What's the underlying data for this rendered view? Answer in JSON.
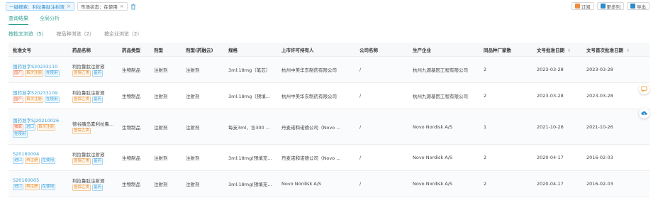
{
  "filters": [
    {
      "label": "一键搜索：利拉鲁肽注射液",
      "active": true
    },
    {
      "label": "市场状态：在使用",
      "active": false
    }
  ],
  "actions": [
    {
      "label": "订阅",
      "color": "#f08a3c"
    },
    {
      "label": "更多列",
      "color": "#2b8ccc"
    },
    {
      "label": "导出",
      "color": "#2b8ccc"
    }
  ],
  "tabs": [
    {
      "label": "查询结果"
    },
    {
      "label": "全局分析"
    }
  ],
  "subtabs": [
    {
      "label": "按批文浏览（5）"
    },
    {
      "label": "按品种浏览（2）"
    },
    {
      "label": "按企业浏览（2）"
    }
  ],
  "columns": [
    {
      "label": "批准文号",
      "sort": false
    },
    {
      "label": "药品名称",
      "sort": false
    },
    {
      "label": "药品类型",
      "sort": false
    },
    {
      "label": "剂型",
      "sort": false
    },
    {
      "label": "剂型(药融云)",
      "sort": false
    },
    {
      "label": "规格",
      "sort": false
    },
    {
      "label": "上市许可持有人",
      "sort": false
    },
    {
      "label": "公司名称",
      "sort": false
    },
    {
      "label": "生产企业",
      "sort": false
    },
    {
      "label": "同品种厂家数",
      "sort": false
    },
    {
      "label": "文号批准日期",
      "sort": true
    },
    {
      "label": "文号首次批准日期",
      "sort": true
    }
  ],
  "rows": [
    {
      "approval": "国药准字S20233110",
      "approval_tags": [
        [
          "国产",
          "red"
        ],
        [
          "首次注册",
          "orange"
        ],
        [
          "在使用",
          "teal"
        ]
      ],
      "drug": "利拉鲁肽注射液",
      "drug_tags": [
        [
          "医保乙类",
          "orange"
        ],
        [
          "基药",
          "blue"
        ]
      ],
      "type": "生物制品",
      "form": "注射剂",
      "form2": "注射剂",
      "spec": "3ml:18mg（笔芯）",
      "holder": "杭州中美华东制药有限公司",
      "company": "/",
      "maker": "杭州九源基因工程有限公司",
      "count": "2",
      "date": "2023-03-28",
      "first_date": "2023-03-28"
    },
    {
      "approval": "国药准字S20233109",
      "approval_tags": [
        [
          "国产",
          "red"
        ],
        [
          "首次注册",
          "orange"
        ],
        [
          "在使用",
          "teal"
        ]
      ],
      "drug": "利拉鲁肽注射液",
      "drug_tags": [
        [
          "医保乙类",
          "orange"
        ],
        [
          "基药",
          "blue"
        ]
      ],
      "type": "生物制品",
      "form": "注射剂",
      "form2": "注射剂",
      "spec": "3ml:18mg（预填...",
      "holder": "杭州中美华东制药有限公司",
      "company": "/",
      "maker": "杭州九源基因工程有限公司",
      "count": "2",
      "date": "2023-03-28",
      "first_date": "2023-03-28"
    },
    {
      "approval": "国药准字SJ20210026",
      "approval_tags": [
        [
          "独家",
          "red"
        ],
        [
          "进口",
          "blue"
        ],
        [
          "首次注册",
          "orange"
        ],
        [
          "在使用",
          "teal"
        ]
      ],
      "drug": "德谷胰岛素利拉鲁...",
      "drug_tags": [
        [
          "医保乙类",
          "orange"
        ]
      ],
      "type": "生物制品",
      "form": "注射剂",
      "form2": "注射剂",
      "spec": "每支3ml，含300 ...",
      "holder": "丹麦诺和诺德公司（Novo ...",
      "company": "/",
      "maker": "Novo Nordisk A/S",
      "count": "1",
      "date": "2021-10-26",
      "first_date": "2021-10-26"
    },
    {
      "approval": "S20160004",
      "approval_tags": [
        [
          "进口",
          "blue"
        ],
        [
          "再注册",
          "orange"
        ],
        [
          "在使用",
          "teal"
        ]
      ],
      "drug": "利拉鲁肽注射液",
      "drug_tags": [
        [
          "医保乙类",
          "orange"
        ],
        [
          "基药",
          "blue"
        ]
      ],
      "type": "生物制品",
      "form": "注射剂",
      "form2": "注射剂",
      "spec": "3ml:18mg(预填充...",
      "holder": "丹麦诺和诺德公司（Novo ...",
      "company": "/",
      "maker": "Novo Nordisk A/S",
      "count": "2",
      "date": "2020-04-17",
      "first_date": "2016-02-03"
    },
    {
      "approval": "S20160005",
      "approval_tags": [
        [
          "进口",
          "blue"
        ],
        [
          "再注册",
          "orange"
        ],
        [
          "在使用",
          "teal"
        ]
      ],
      "drug": "利拉鲁肽注射液",
      "drug_tags": [
        [
          "医保乙类",
          "orange"
        ],
        [
          "基药",
          "blue"
        ]
      ],
      "type": "生物制品",
      "form": "注射剂",
      "form2": "注射剂",
      "spec": "3ml:18mg(预填充...",
      "holder": "Novo Nordisk A/S",
      "company": "/",
      "maker": "Novo Nordisk A/S",
      "count": "2",
      "date": "2020-04-17",
      "first_date": "2016-02-03"
    }
  ]
}
